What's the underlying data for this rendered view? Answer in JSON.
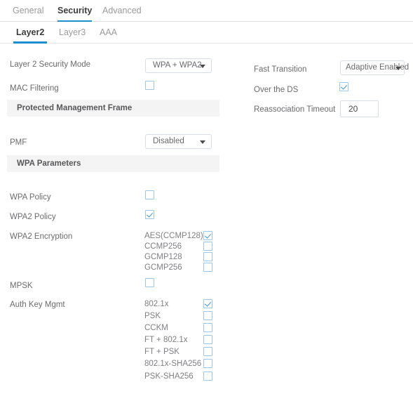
{
  "tabs_primary": [
    {
      "label": "General",
      "active": false
    },
    {
      "label": "Security",
      "active": true
    },
    {
      "label": "Advanced",
      "active": false
    }
  ],
  "tabs_secondary": [
    {
      "label": "Layer2",
      "active": true
    },
    {
      "label": "Layer3",
      "active": false
    },
    {
      "label": "AAA",
      "active": false
    }
  ],
  "left_column": {
    "security_mode": {
      "label": "Layer 2 Security Mode",
      "value": "WPA + WPA2"
    },
    "mac_filtering": {
      "label": "MAC Filtering",
      "checked": false
    },
    "pmf_section": {
      "header": "Protected Management Frame"
    },
    "pmf": {
      "label": "PMF",
      "value": "Disabled"
    },
    "wpa_section": {
      "header": "WPA Parameters"
    },
    "wpa_policy": {
      "label": "WPA Policy",
      "checked": false
    },
    "wpa2_policy": {
      "label": "WPA2 Policy",
      "checked": true
    },
    "wpa2_encryption": {
      "label": "WPA2 Encryption",
      "options": [
        {
          "label": "AES(CCMP128)",
          "checked": true
        },
        {
          "label": "CCMP256",
          "checked": false
        },
        {
          "label": "GCMP128",
          "checked": false
        },
        {
          "label": "GCMP256",
          "checked": false
        }
      ]
    },
    "mpsk": {
      "label": "MPSK",
      "checked": false
    },
    "auth_key_mgmt": {
      "label": "Auth Key Mgmt",
      "options": [
        {
          "label": "802.1x",
          "checked": true
        },
        {
          "label": "PSK",
          "checked": false
        },
        {
          "label": "CCKM",
          "checked": false
        },
        {
          "label": "FT + 802.1x",
          "checked": false
        },
        {
          "label": "FT + PSK",
          "checked": false
        },
        {
          "label": "802.1x-SHA256",
          "checked": false
        },
        {
          "label": "PSK-SHA256",
          "checked": false
        }
      ]
    }
  },
  "right_column": {
    "fast_transition": {
      "label": "Fast Transition",
      "value": "Adaptive Enabled"
    },
    "over_the_ds": {
      "label": "Over the DS",
      "checked": true
    },
    "reassociation_timeout": {
      "label": "Reassociation Timeout",
      "value": "20"
    }
  },
  "colors": {
    "accent": "#1b8fcf",
    "checkbox_border": "#9cc7e8",
    "check_mark": "#3b9ad9",
    "section_bg": "#f4f4f5",
    "text": "#6b6b6e",
    "divider": "#e4e4e4"
  }
}
